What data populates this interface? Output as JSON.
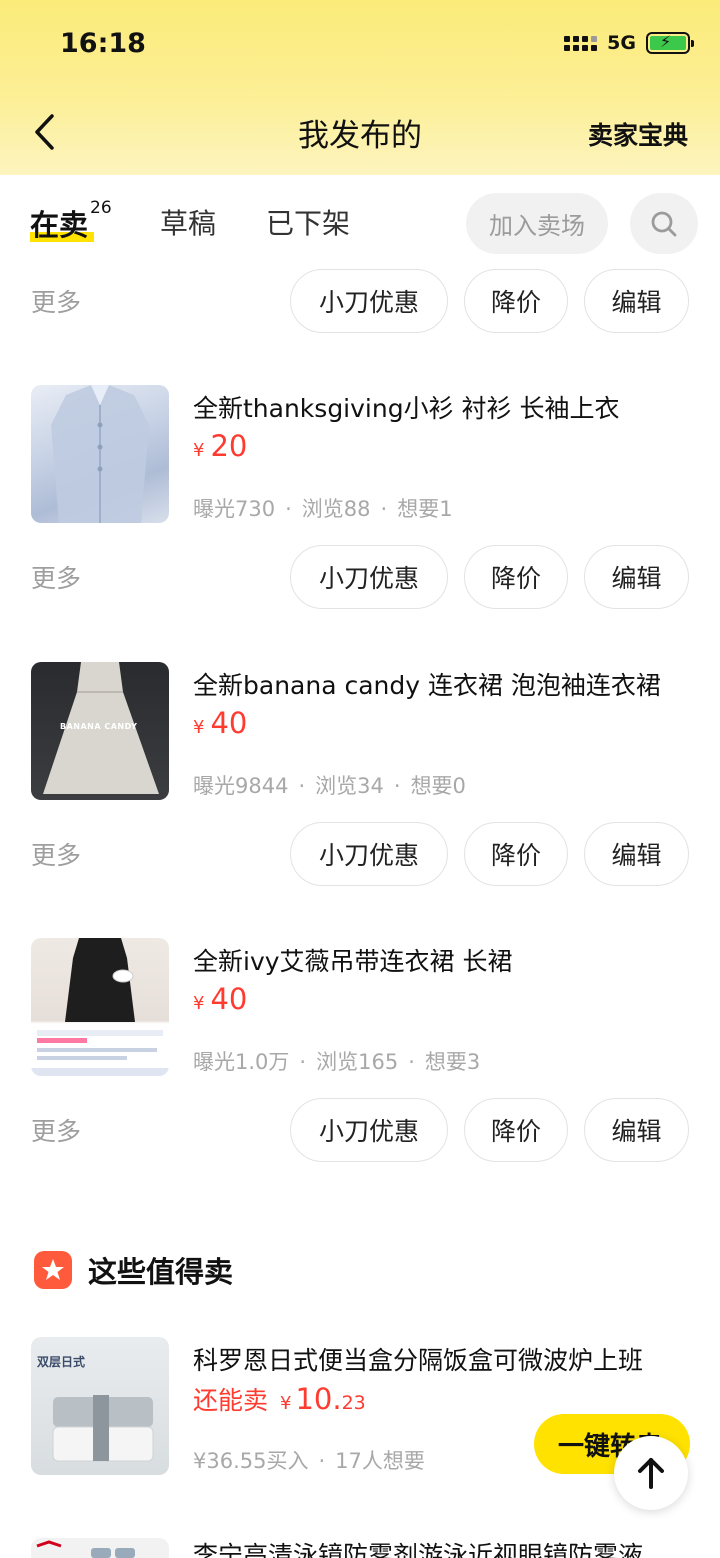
{
  "status_bar": {
    "time": "16:18",
    "network": "5G",
    "battery_color": "#3cc84b"
  },
  "nav": {
    "back_icon": "chevron-left-icon",
    "title": "我发布的",
    "right_link": "卖家宝典"
  },
  "tabs": {
    "active": {
      "label": "在卖",
      "count": "26"
    },
    "draft": "草稿",
    "off_shelf": "已下架",
    "join_market": "加入卖场",
    "search_icon": "search-icon"
  },
  "actions": {
    "more": "更多",
    "discount": "小刀优惠",
    "reduce_price": "降价",
    "edit": "编辑"
  },
  "items": [
    {
      "title": "全新thanksgiving小衫 衬衫 长袖上衣",
      "currency": "¥",
      "price": "20",
      "exposure": "曝光730",
      "views": "浏览88",
      "wants": "想要1"
    },
    {
      "title": "全新banana candy 连衣裙 泡泡袖连衣裙",
      "currency": "¥",
      "price": "40",
      "thumb_text": "BANANA CANDY",
      "exposure": "曝光9844",
      "views": "浏览34",
      "wants": "想要0"
    },
    {
      "title": "全新ivy艾薇吊带连衣裙 长裙",
      "currency": "¥",
      "price": "40",
      "exposure": "曝光1.0万",
      "views": "浏览165",
      "wants": "想要3"
    }
  ],
  "worth_selling": {
    "title": "这些值得卖",
    "badge_color": "#ff5a3c",
    "item": {
      "title": "科罗恩日式便当盒分隔饭盒可微波炉上班",
      "thumb_text": "双层日式",
      "can_sell": "还能卖",
      "currency": "¥",
      "price_int": "10.",
      "price_dec": "23",
      "bought": "¥36.55买入",
      "wants": "17人想要",
      "button": "一键转卖"
    },
    "next_item_title": "李宁高清泳镜防雾剂游泳近视眼镜防雾液"
  },
  "colors": {
    "accent_yellow": "#ffe200",
    "price_red": "#ff3b30"
  }
}
